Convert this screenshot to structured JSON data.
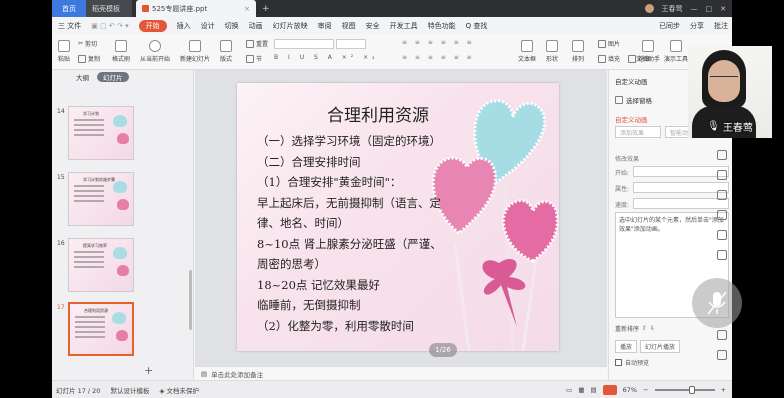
{
  "titlebar": {
    "home_tab": "首页",
    "doc_tab": "稻壳模板",
    "file_tab": "525专题讲座.ppt",
    "user_name": "王春莺"
  },
  "menubar": {
    "file": "三 文件",
    "items": [
      "开始",
      "插入",
      "设计",
      "切换",
      "动画",
      "幻灯片放映",
      "审阅",
      "视图",
      "安全",
      "开发工具",
      "特色功能"
    ],
    "search": "Q 查找",
    "sync": "已同步",
    "share": "分享",
    "comment": "批注"
  },
  "toolbar": {
    "cut": "剪切",
    "copy": "复制",
    "format_painter": "格式刷",
    "paste": "粘贴",
    "from_current": "从当前开始",
    "new_slide": "新建幻灯片",
    "layout": "版式",
    "reset": "重置",
    "section": "节",
    "textbox": "文本框",
    "shape": "形状",
    "arrange": "排列",
    "picture": "图片",
    "fill": "填充",
    "outline": "轮廓",
    "doc_assistant": "文档助手",
    "presenter": "演示工具"
  },
  "left_panel": {
    "tab_outline": "大纲",
    "tab_slides": "幻灯片",
    "thumbs": [
      {
        "num": "14",
        "title": "学习计划"
      },
      {
        "num": "15",
        "title": "学习计划实施步骤"
      },
      {
        "num": "16",
        "title": "提高学习效率"
      },
      {
        "num": "17",
        "title": "合理利用资源"
      }
    ]
  },
  "slide": {
    "title": "合理利用资源",
    "lines": [
      "（一）选择学习环境（固定的环境）",
      "（二）合理安排时间",
      "（1）合理安排\"黄金时间\"：",
      "早上起床后，无前摄抑制（语言、定",
      "律、地名、时间）",
      "8~10点 肾上腺素分泌旺盛（严谨、",
      "周密的思考）",
      "18~20点 记忆效果最好",
      "临睡前，无倒摄抑制",
      "（2）化整为零，利用零散时间"
    ],
    "page_indicator": "1/26",
    "notes": "单击此处添加备注"
  },
  "right_panel": {
    "title": "自定义动画",
    "select_pane": "选择窗格",
    "section": "自定义动画",
    "add_effect": "添加效果",
    "smart_anim": "智能动画",
    "delete": "删除",
    "modify": "修改效果",
    "start_label": "开始:",
    "prop_label": "属性:",
    "speed_label": "速度:",
    "hint": "选中幻灯片的某个元素，然后单击\"添加效果\"添加动画。",
    "reorder": "重新排序",
    "play": "播放",
    "slideshow": "幻灯片播放",
    "autopreview": "自动预览"
  },
  "webcam": {
    "name": "王春莺"
  },
  "statusbar": {
    "slide_count": "幻灯片 17 / 20",
    "template": "默认设计模板",
    "doc_protect": "文档未保护",
    "zoom": "67%"
  },
  "colors": {
    "accent": "#e2573a",
    "titlebar": "#2d2f33",
    "home_tab": "#3d7ae0"
  }
}
